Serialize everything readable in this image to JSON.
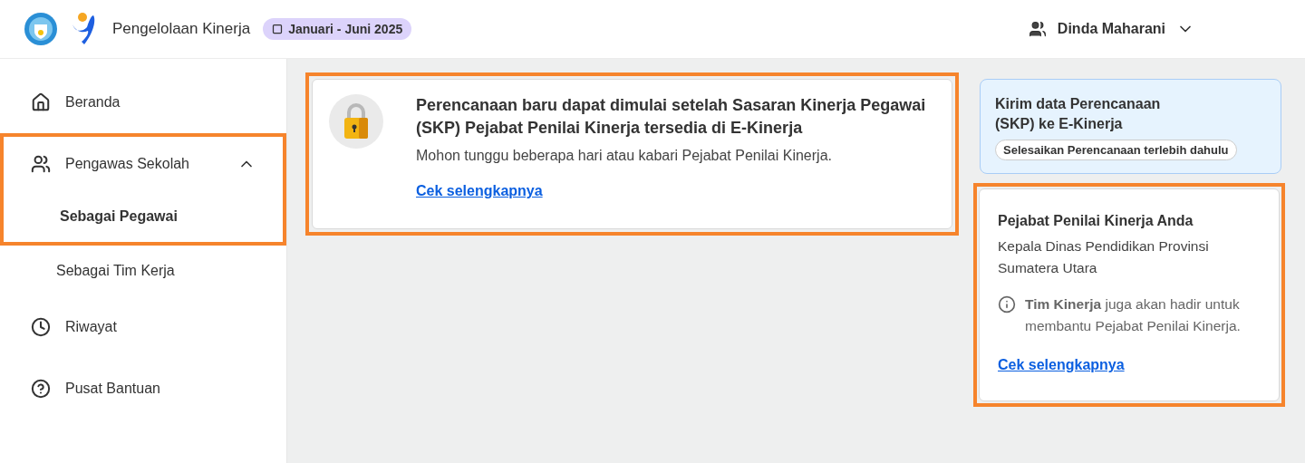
{
  "header": {
    "app_title": "Pengelolaan Kinerja",
    "period": "Januari - Juni 2025",
    "user": "Dinda Maharani"
  },
  "sidebar": {
    "items": [
      {
        "kind": "home",
        "label": "Beranda",
        "selected": false,
        "highlighted": false
      },
      {
        "kind": "people",
        "label": "Pengawas Sekolah",
        "selected": false,
        "expanded": true,
        "highlighted": true,
        "children": [
          {
            "label": "Sebagai Pegawai",
            "selected": true
          },
          {
            "label": "Sebagai Tim Kerja",
            "selected": false
          }
        ]
      },
      {
        "kind": "clock",
        "label": "Riwayat",
        "selected": false,
        "highlighted": false
      },
      {
        "kind": "help",
        "label": "Pusat Bantuan",
        "selected": false,
        "highlighted": false
      }
    ]
  },
  "notice_card": {
    "highlighted": true,
    "title": "Perencanaan baru dapat dimulai setelah Sasaran Kinerja Pegawai (SKP) Pejabat Penilai Kinerja tersedia di E-Kinerja",
    "message": "Mohon tunggu beberapa hari atau kabari Pejabat Penilai Kinerja.",
    "link": "Cek selengkapnya"
  },
  "send_card": {
    "title": "Kirim data Perencanaan (SKP) ke E-Kinerja",
    "status": "Selesaikan Perencanaan terlebih dahulu"
  },
  "assessor_card": {
    "highlighted": true,
    "heading": "Pejabat Penilai Kinerja Anda",
    "name": "Kepala Dinas Pendidikan Provinsi Sumatera Utara",
    "info": "**Tim Kinerja** juga akan hadir untuk membantu Pejabat Penilai Kinerja.",
    "link": "Cek selengkapnya"
  }
}
